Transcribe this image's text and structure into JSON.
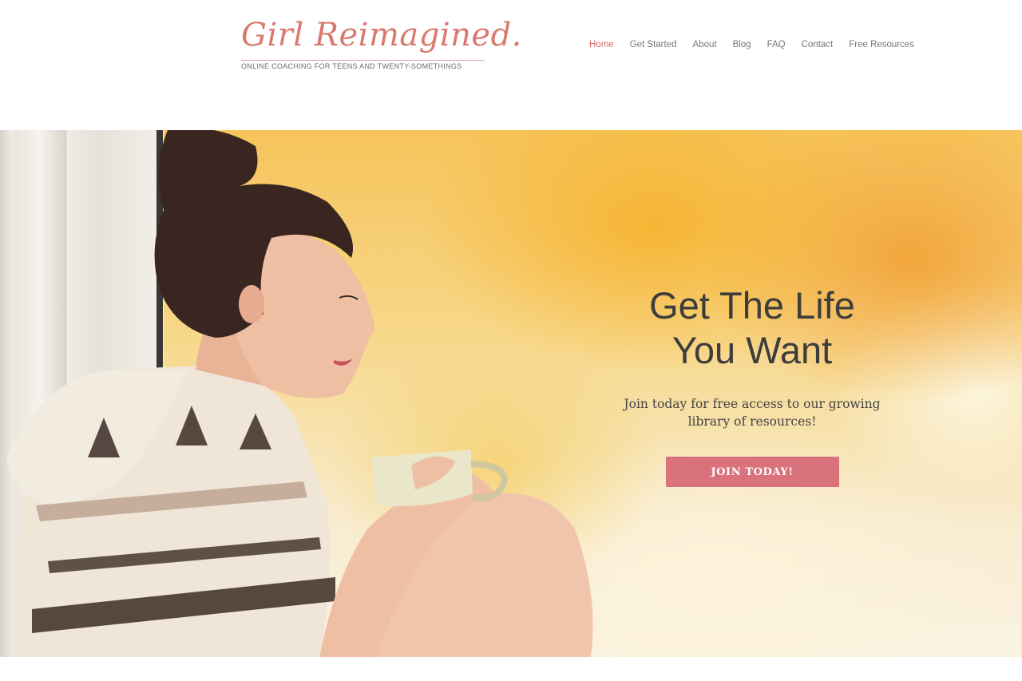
{
  "brand": {
    "name": "Girl Reimagined.",
    "tagline": "ONLINE COACHING FOR TEENS AND TWENTY-SOMETHINGS",
    "accent_color": "#d9695f"
  },
  "nav": {
    "items": [
      {
        "label": "Home",
        "active": true
      },
      {
        "label": "Get Started",
        "active": false
      },
      {
        "label": "About",
        "active": false
      },
      {
        "label": "Blog",
        "active": false
      },
      {
        "label": "FAQ",
        "active": false
      },
      {
        "label": "Contact",
        "active": false
      },
      {
        "label": "Free Resources",
        "active": false
      }
    ]
  },
  "hero": {
    "title_line1": "Get The Life",
    "title_line2": "You Want",
    "subtitle": "Join today for free access to our growing library of resources!",
    "cta_label": "JOIN TODAY!",
    "cta_color": "#d9727a"
  }
}
